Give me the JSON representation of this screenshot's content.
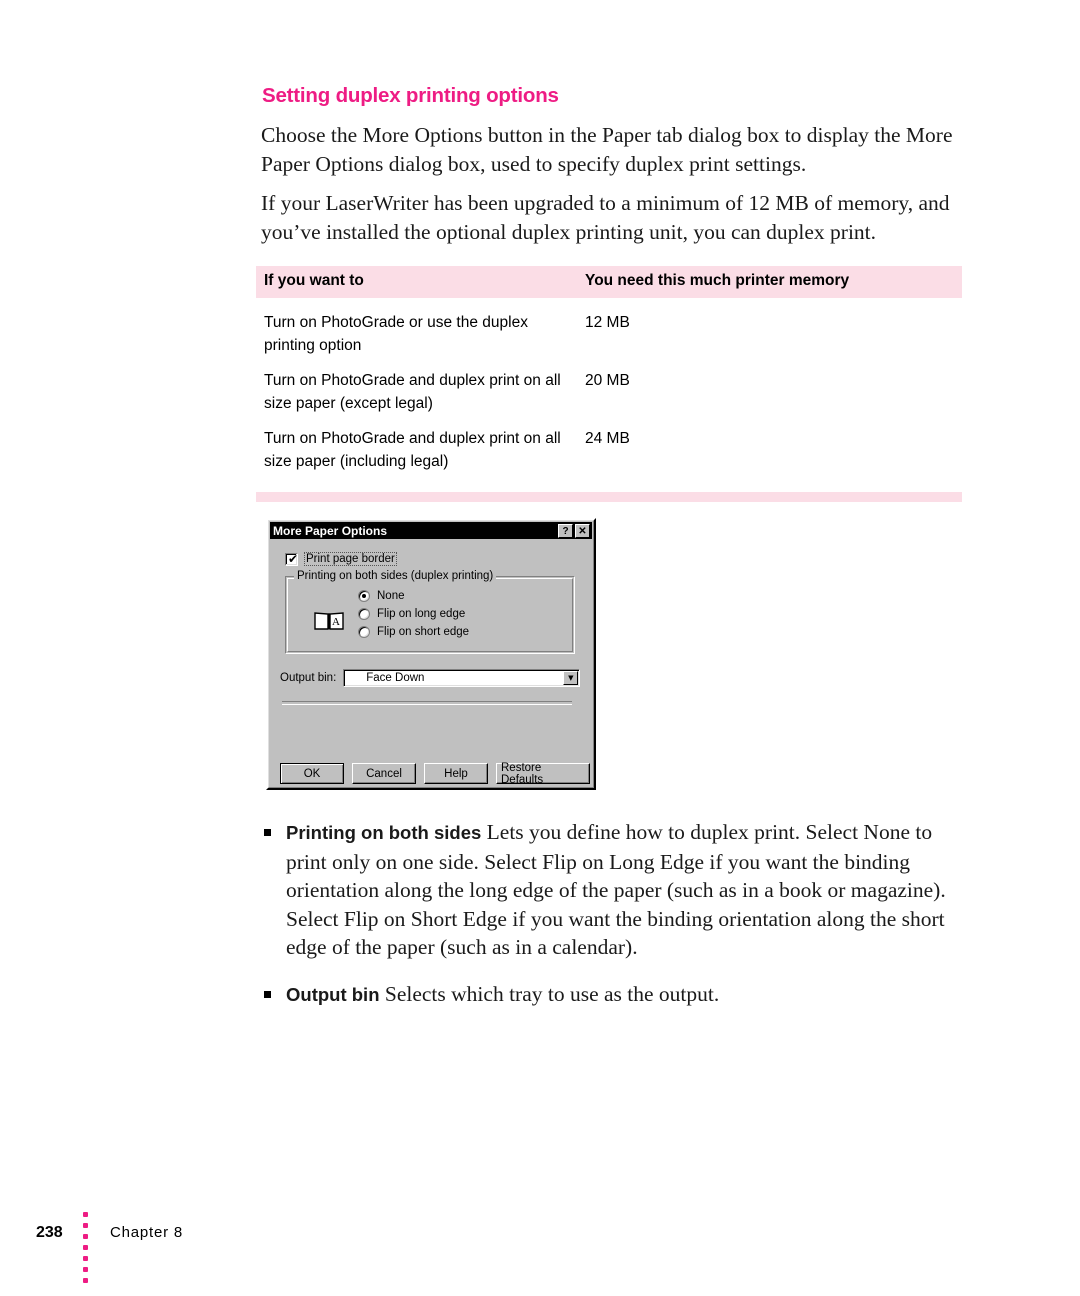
{
  "heading": "Setting duplex printing options",
  "paragraphs": {
    "p1": "Choose the More Options button in the Paper tab dialog box to display the More Paper Options dialog box, used to specify duplex print settings.",
    "p2": "If your LaserWriter has been upgraded to a minimum of 12 MB of memory, and you’ve installed the optional duplex printing unit, you can duplex print."
  },
  "memory_table": {
    "headers": [
      "If you want to",
      "You need this much printer memory"
    ],
    "rows": [
      {
        "want": "Turn on PhotoGrade or use the duplex printing option",
        "memory": "12 MB"
      },
      {
        "want": "Turn on PhotoGrade and duplex print on all size paper (except legal)",
        "memory": "20 MB"
      },
      {
        "want": "Turn on PhotoGrade and duplex print on all size paper (including legal)",
        "memory": "24 MB"
      }
    ]
  },
  "dialog": {
    "title": "More Paper Options",
    "help_button": "?",
    "close_button": "✕",
    "print_page_border": {
      "label": "Print page border",
      "checked": true,
      "tick": "✔"
    },
    "group": {
      "legend": "Printing on both sides (duplex printing)",
      "icon": "book-with-letter-a-icon",
      "options": [
        {
          "label": "None",
          "selected": true
        },
        {
          "label": "Flip on long edge",
          "selected": false
        },
        {
          "label": "Flip on short edge",
          "selected": false
        }
      ]
    },
    "output_bin": {
      "label": "Output bin:",
      "value": "Face Down",
      "arrow": "▼"
    },
    "buttons": [
      {
        "label": "OK",
        "default": true
      },
      {
        "label": "Cancel",
        "default": false
      },
      {
        "label": "Help",
        "default": false
      },
      {
        "label": "Restore Defaults",
        "default": false
      }
    ]
  },
  "bullets": [
    {
      "term": "Printing on both sides",
      "text": "Lets you define how to duplex print. Select None to print only on one side. Select Flip on Long Edge if you want the binding orientation along the long edge of the paper (such as in a book or magazine). Select Flip on Short Edge if you want the binding orientation along the short edge of the paper (such as in a calendar)."
    },
    {
      "term": "Output bin",
      "text": "Selects which tray to use as the output."
    }
  ],
  "footer": {
    "page_number": "238",
    "chapter": "Chapter 8",
    "dot_count": 6,
    "dot_color": "#ee1c84"
  },
  "colors": {
    "accent_magenta": "#ee1c84",
    "table_header_pink": "#fbdde6",
    "dialog_face": "#c0c0c0"
  }
}
